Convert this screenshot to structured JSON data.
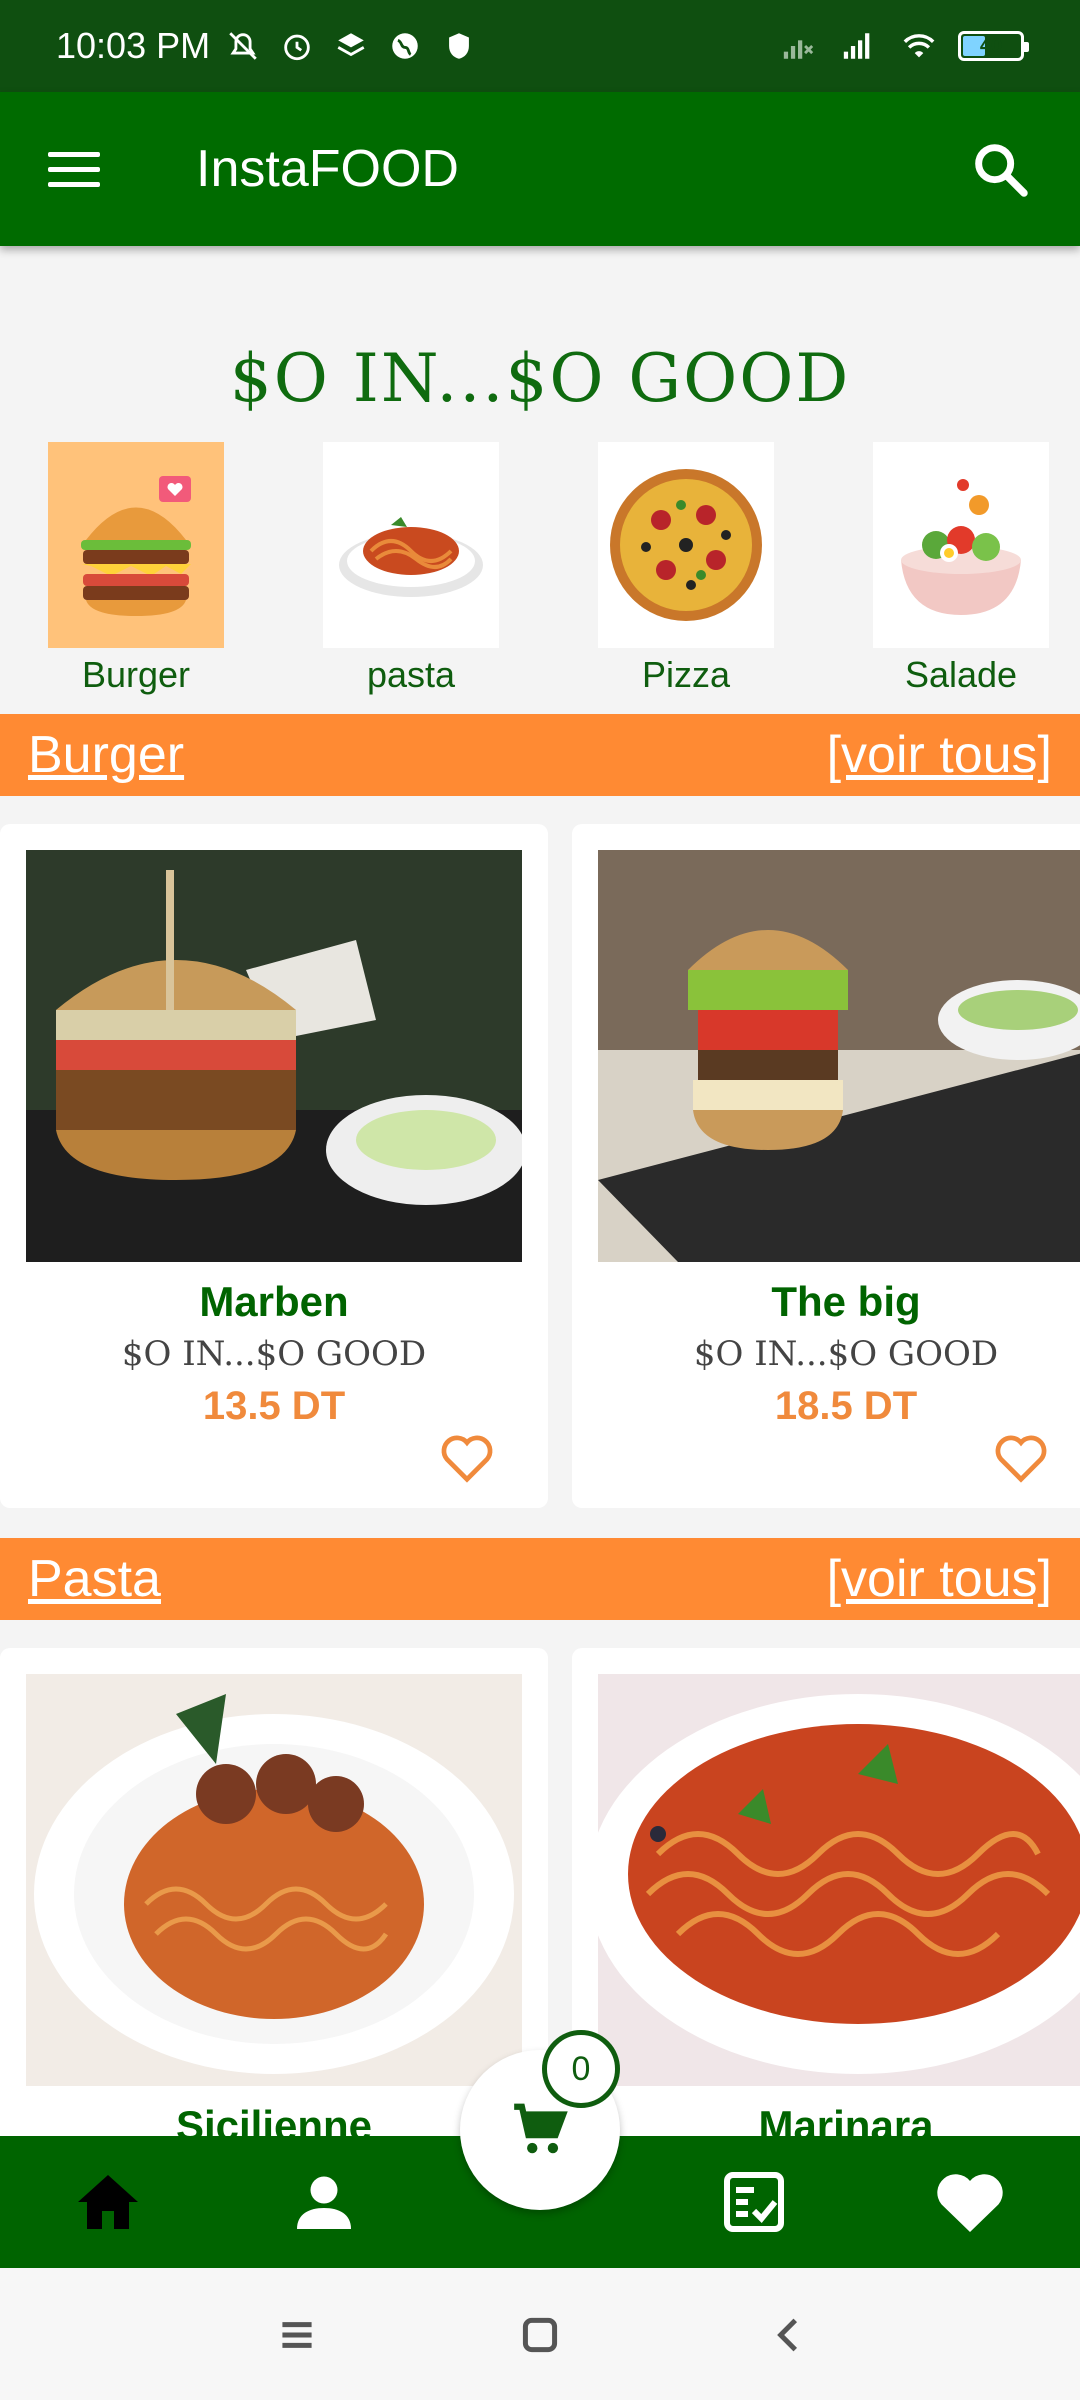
{
  "status_bar": {
    "time": "10:03 PM",
    "battery": "40",
    "icons": [
      "mute-icon",
      "alarm-icon",
      "layers-icon",
      "globe-icon",
      "shield-icon",
      "signal-off-icon",
      "signal-icon",
      "wifi-icon",
      "battery-icon"
    ]
  },
  "appbar": {
    "title": "InstaFOOD",
    "icons": [
      "menu-icon",
      "search-icon"
    ]
  },
  "slogan": "$O IN...$O GOOD",
  "categories": [
    {
      "label": "Burger"
    },
    {
      "label": "pasta"
    },
    {
      "label": "Pizza"
    },
    {
      "label": "Salade"
    }
  ],
  "sections": [
    {
      "title": "Burger",
      "see_all": "[voir tous]",
      "items": [
        {
          "name": "Marben",
          "tagline": "$O IN...$O GOOD",
          "price": "13.5 DT"
        },
        {
          "name": "The big",
          "tagline": "$O IN...$O GOOD",
          "price": "18.5 DT"
        }
      ]
    },
    {
      "title": "Pasta",
      "see_all": "[voir tous]",
      "items": [
        {
          "name": "Sicilienne"
        },
        {
          "name": "Marinara"
        }
      ]
    }
  ],
  "cart": {
    "count": "0"
  },
  "bottom_nav": [
    "home-icon",
    "person-icon",
    "cart-icon",
    "checklist-icon",
    "heart-icon"
  ],
  "colors": {
    "primary": "#006400",
    "accent": "#ff8a33",
    "price": "#f08a3c"
  }
}
